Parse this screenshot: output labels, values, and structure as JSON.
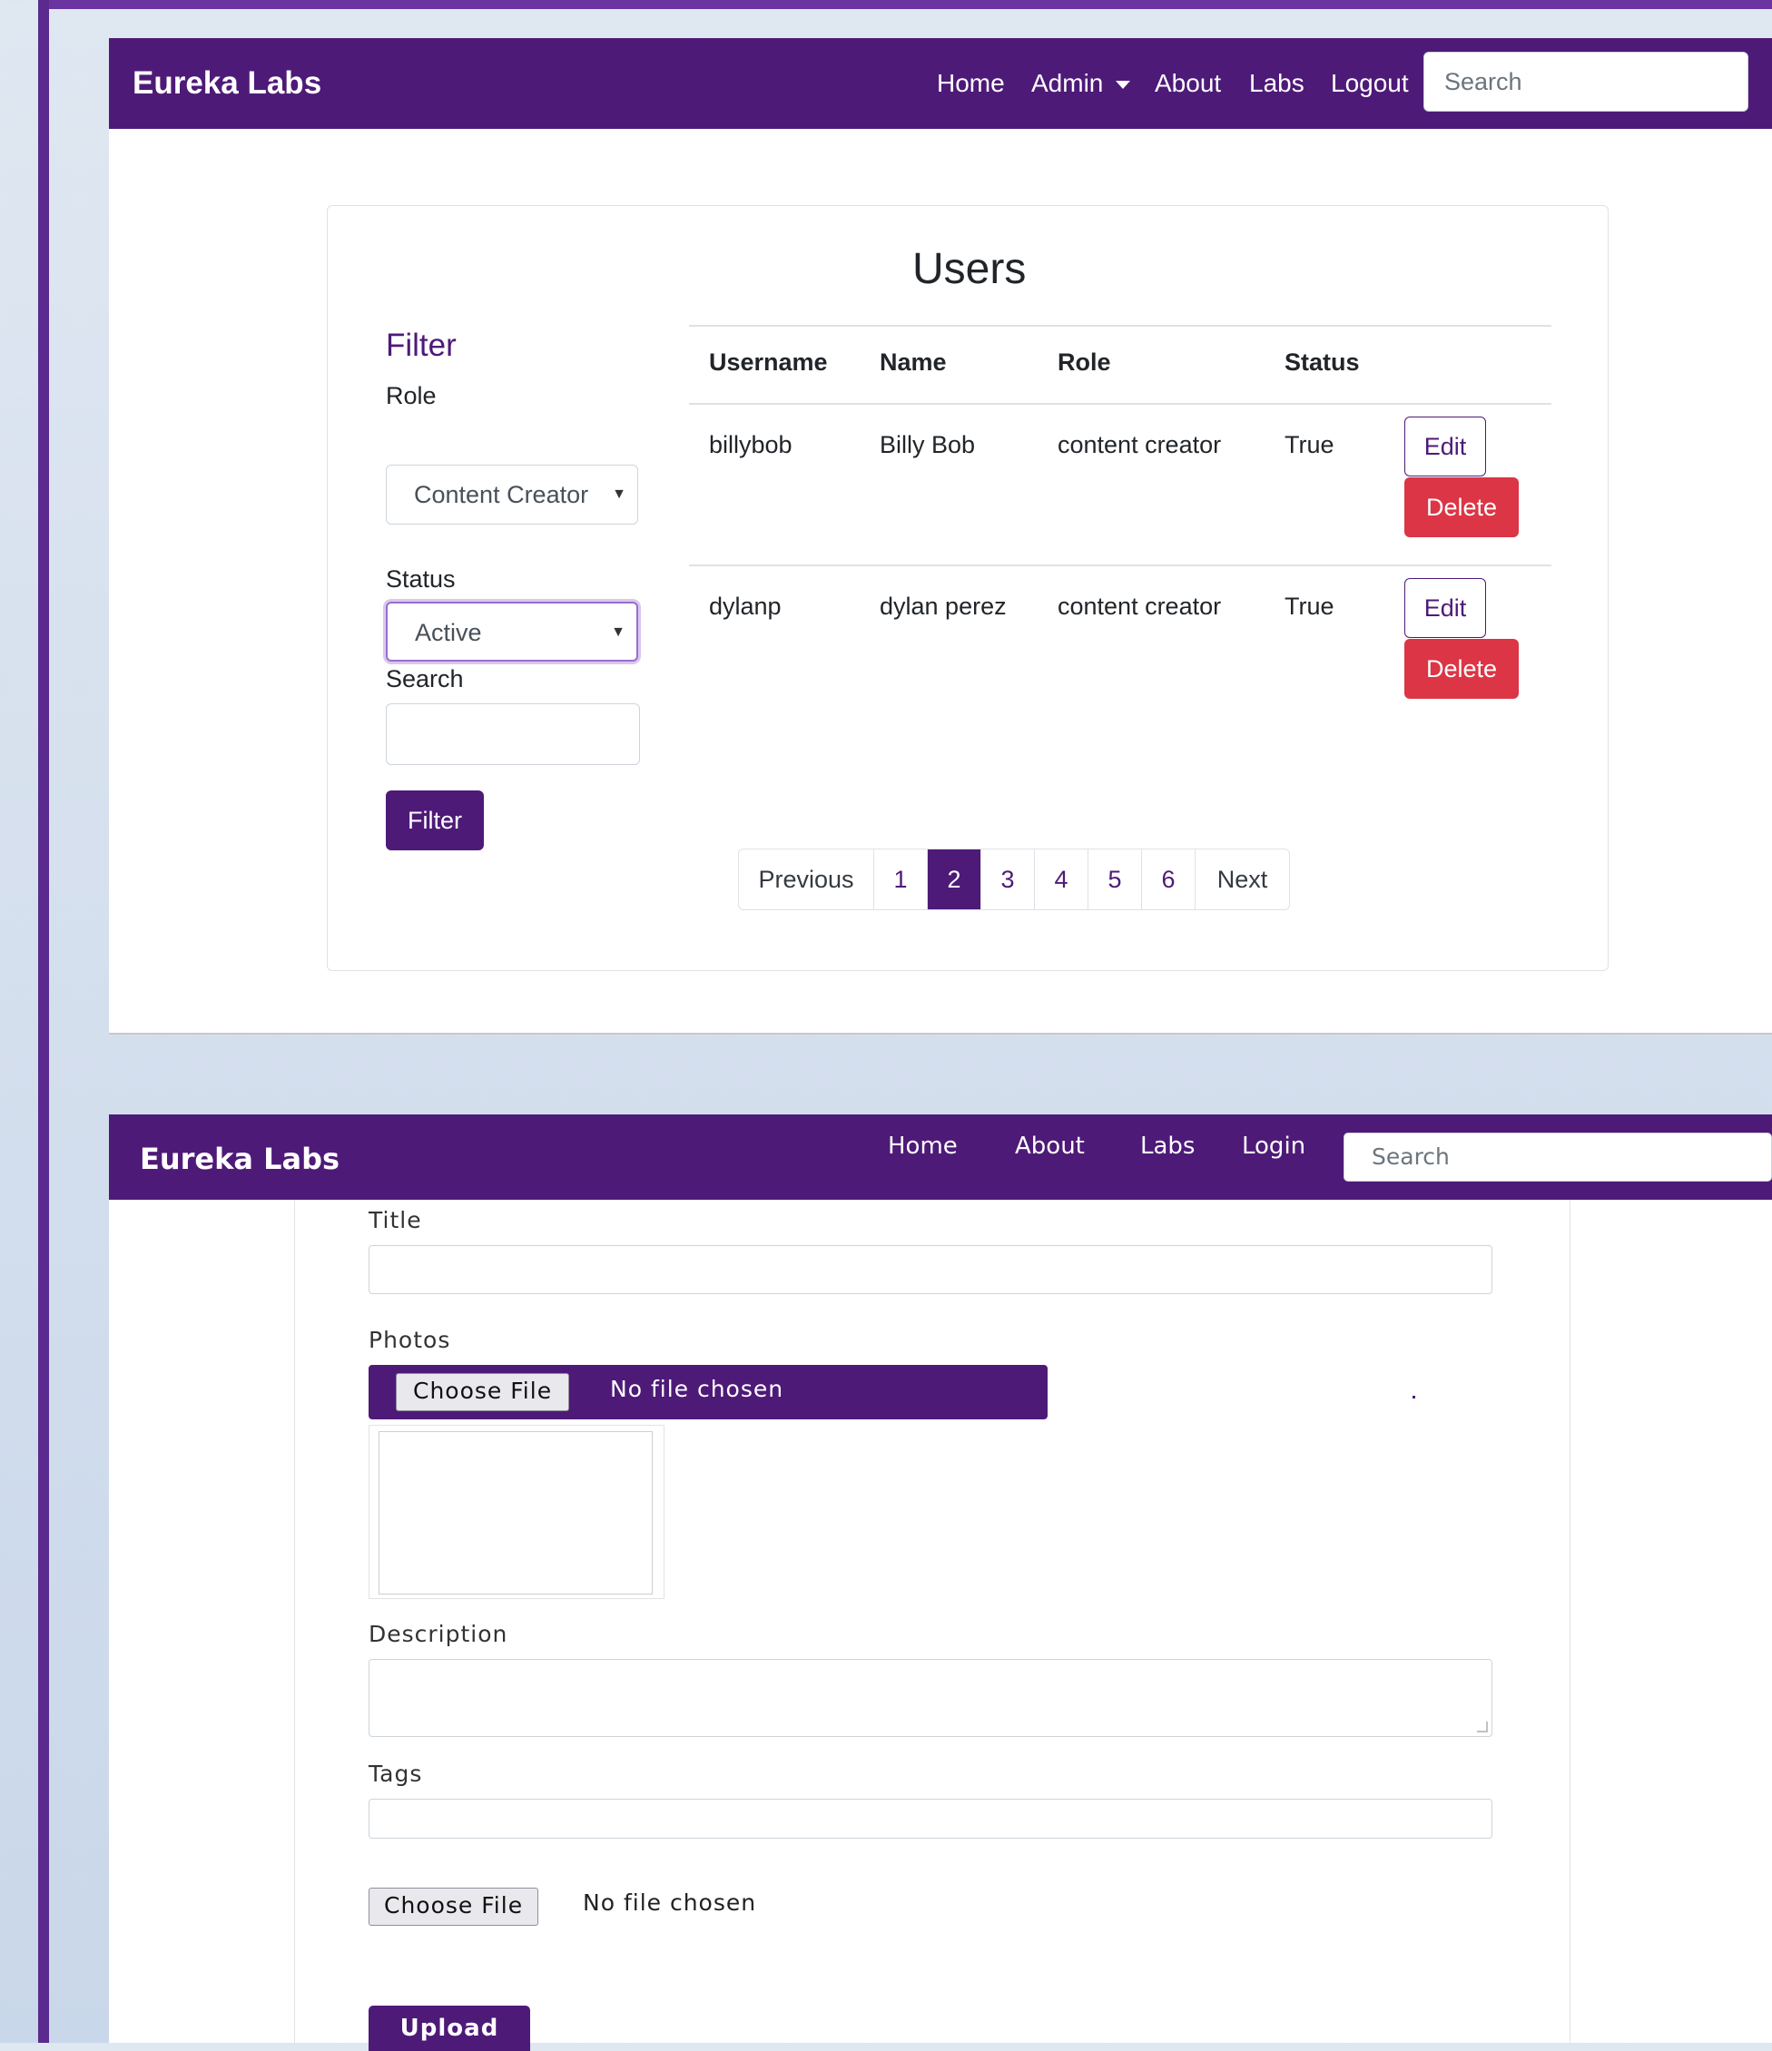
{
  "colors": {
    "primary": "#4e1a78",
    "danger": "#dc3545",
    "frame": "#5b2a8e",
    "background": "#d6e0ee"
  },
  "top": {
    "navbar": {
      "brand": "Eureka Labs",
      "links": [
        "Home",
        "Admin",
        "About",
        "Labs",
        "Logout"
      ],
      "search_placeholder": "Search"
    },
    "page_title": "Users",
    "filter": {
      "title": "Filter",
      "role_label": "Role",
      "role_value": "Content Creator",
      "status_label": "Status",
      "status_value": "Active",
      "search_label": "Search",
      "search_value": "",
      "button": "Filter"
    },
    "table": {
      "headers": [
        "Username",
        "Name",
        "Role",
        "Status"
      ],
      "rows": [
        {
          "username": "billybob",
          "name": "Billy Bob",
          "role": "content creator",
          "status": "True"
        },
        {
          "username": "dylanp",
          "name": "dylan perez",
          "role": "content creator",
          "status": "True"
        }
      ],
      "edit_label": "Edit",
      "delete_label": "Delete"
    },
    "pagination": {
      "previous": "Previous",
      "pages": [
        "1",
        "2",
        "3",
        "4",
        "5",
        "6"
      ],
      "active": "2",
      "next": "Next"
    }
  },
  "bottom": {
    "navbar": {
      "brand": "Eureka Labs",
      "links": [
        "Home",
        "About",
        "Labs",
        "Login"
      ],
      "search_placeholder": "Search"
    },
    "form": {
      "title_label": "Title",
      "photos_label": "Photos",
      "choose_file": "Choose File",
      "no_file": "No file chosen",
      "description_label": "Description",
      "tags_label": "Tags",
      "choose_file_2": "Choose File",
      "no_file_2": "No file chosen",
      "upload": "Upload"
    }
  }
}
